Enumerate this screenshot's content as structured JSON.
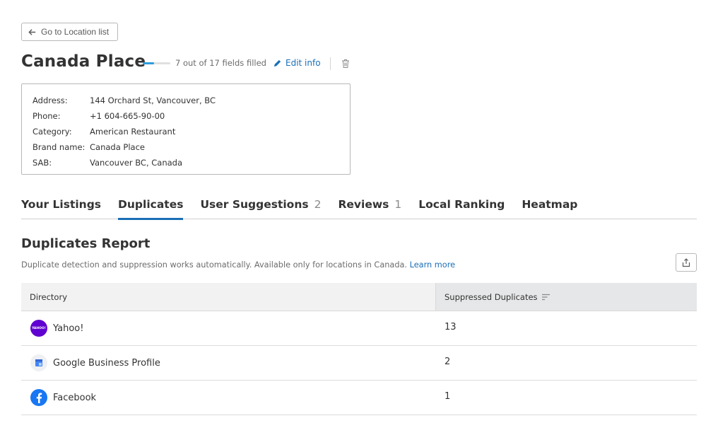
{
  "header": {
    "back_label": "Go to Location list",
    "title": "Canada Place",
    "progress_text": "7 out of 17 fields filled",
    "progress": {
      "filled": 7,
      "total": 17
    },
    "edit_label": "Edit info"
  },
  "info": [
    {
      "label": "Address:",
      "value": "144 Orchard St, Vancouver, BC"
    },
    {
      "label": "Phone:",
      "value": "+1 604-665-90-00"
    },
    {
      "label": "Category:",
      "value": "American Restaurant"
    },
    {
      "label": "Brand name:",
      "value": "Canada Place"
    },
    {
      "label": "SAB:",
      "value": "Vancouver BC, Canada"
    }
  ],
  "tabs": [
    {
      "label": "Your Listings",
      "count": ""
    },
    {
      "label": "Duplicates",
      "count": "",
      "active": true
    },
    {
      "label": "User Suggestions",
      "count": "2"
    },
    {
      "label": "Reviews",
      "count": "1"
    },
    {
      "label": "Local Ranking",
      "count": ""
    },
    {
      "label": "Heatmap",
      "count": ""
    }
  ],
  "report": {
    "title": "Duplicates Report",
    "description": "Duplicate detection and suppression works automatically. Available only for locations in Canada.",
    "learn_more": "Learn more",
    "columns": [
      "Directory",
      "Suppressed Duplicates"
    ],
    "rows": [
      {
        "directory": "Yahoo!",
        "icon": "yahoo-logo-icon",
        "logo_text": "YAHOO!",
        "suppressed": "13"
      },
      {
        "directory": "Google Business Profile",
        "icon": "google-business-profile-logo-icon",
        "suppressed": "2"
      },
      {
        "directory": "Facebook",
        "icon": "facebook-logo-icon",
        "suppressed": "1"
      }
    ]
  },
  "colors": {
    "accent": "#1a6fb7",
    "progress": "#2d9cdb",
    "yahoo": "#5f01d1",
    "facebook": "#1877f2"
  }
}
